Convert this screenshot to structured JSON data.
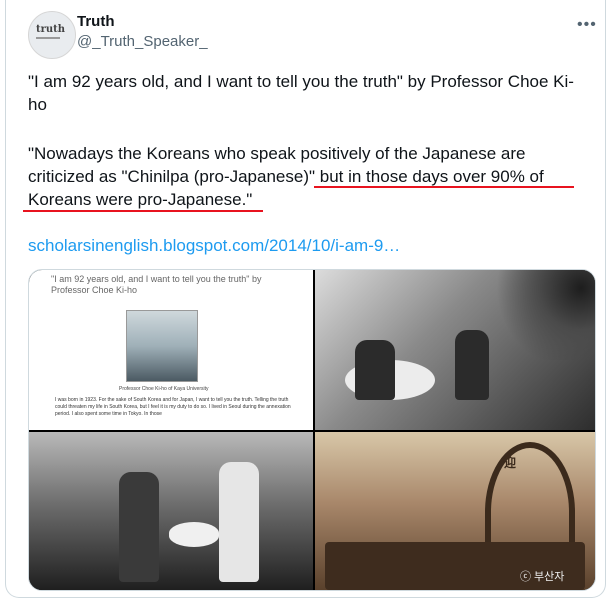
{
  "author": {
    "display_name": "Truth",
    "handle": "@_Truth_Speaker_",
    "avatar_text": "truth"
  },
  "tweet": {
    "line1": "\"I am 92 years old, and I want to tell you the truth\" by Professor Choe Ki-ho",
    "line2": "\"Nowadays the Koreans who speak positively of the Japanese are criticized as \"Chinilpa (pro-Japanese)\" but in those days over 90% of Koreans were pro-Japanese.\"",
    "link": "scholarsinenglish.blogspot.com/2014/10/i-am-9…"
  },
  "media": {
    "doc_title": "\"I am 92 years old, and I want to tell you the truth\" by Professor Choe Ki-ho",
    "doc_caption": "Professor Choe Ki-ho of Kaya University",
    "doc_body": "I was born in 1923. For the sake of South Korea and for Japan, I want to tell you the truth. Telling the truth could threaten my life in South Korea, but I feel it is my duty to do so.\nI lived in Seoul during the annexation period. I also spent some time in Tokyo. In those",
    "gate_label": "迎",
    "watermark": "ⓒ 부산자"
  },
  "colors": {
    "link": "#1d9bf0",
    "underline": "#e8131f"
  }
}
